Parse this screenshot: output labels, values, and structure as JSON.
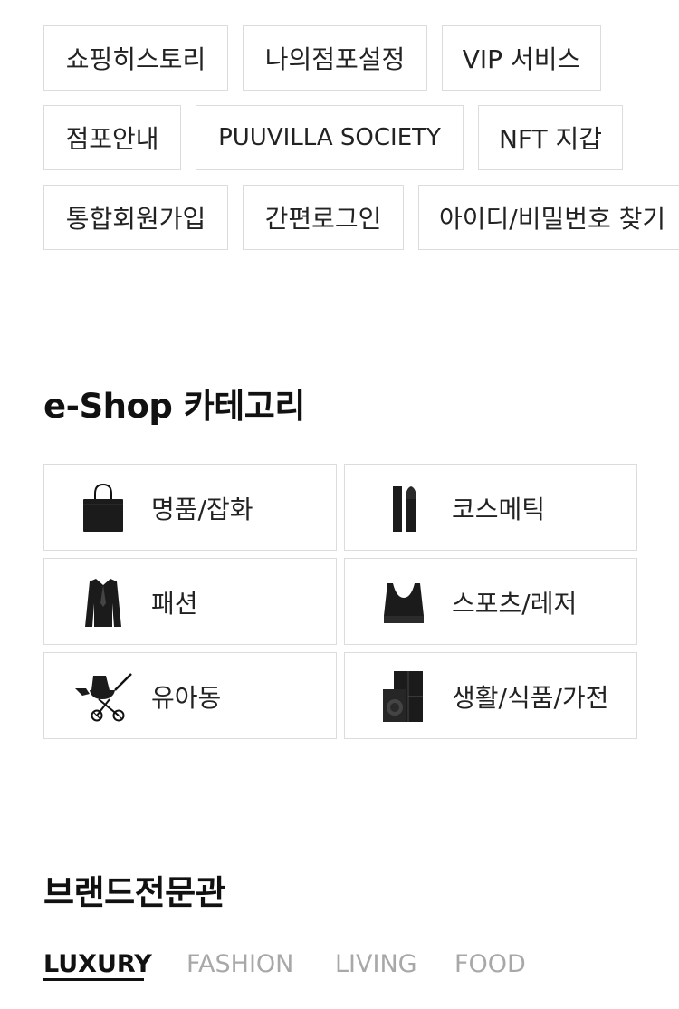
{
  "quick_links": [
    {
      "label": "쇼핑히스토리"
    },
    {
      "label": "나의점포설정"
    },
    {
      "label": "VIP 서비스"
    },
    {
      "label": "점포안내"
    },
    {
      "label": "PUUVILLA SOCIETY"
    },
    {
      "label": "NFT 지갑"
    },
    {
      "label": "통합회원가입"
    },
    {
      "label": "간편로그인"
    },
    {
      "label": "아이디/비밀번호 찾기"
    }
  ],
  "eshop": {
    "title": "e-Shop 카테고리",
    "categories": [
      {
        "label": "명품/잡화",
        "icon": "handbag-icon"
      },
      {
        "label": "코스메틱",
        "icon": "lipstick-icon"
      },
      {
        "label": "패션",
        "icon": "jacket-icon"
      },
      {
        "label": "스포츠/레저",
        "icon": "sports-top-icon"
      },
      {
        "label": "유아동",
        "icon": "stroller-icon"
      },
      {
        "label": "생활/식품/가전",
        "icon": "appliance-icon"
      }
    ]
  },
  "brand": {
    "title": "브랜드전문관",
    "tabs": [
      {
        "label": "LUXURY",
        "active": true
      },
      {
        "label": "FASHION",
        "active": false
      },
      {
        "label": "LIVING",
        "active": false
      },
      {
        "label": "FOOD",
        "active": false
      }
    ]
  }
}
